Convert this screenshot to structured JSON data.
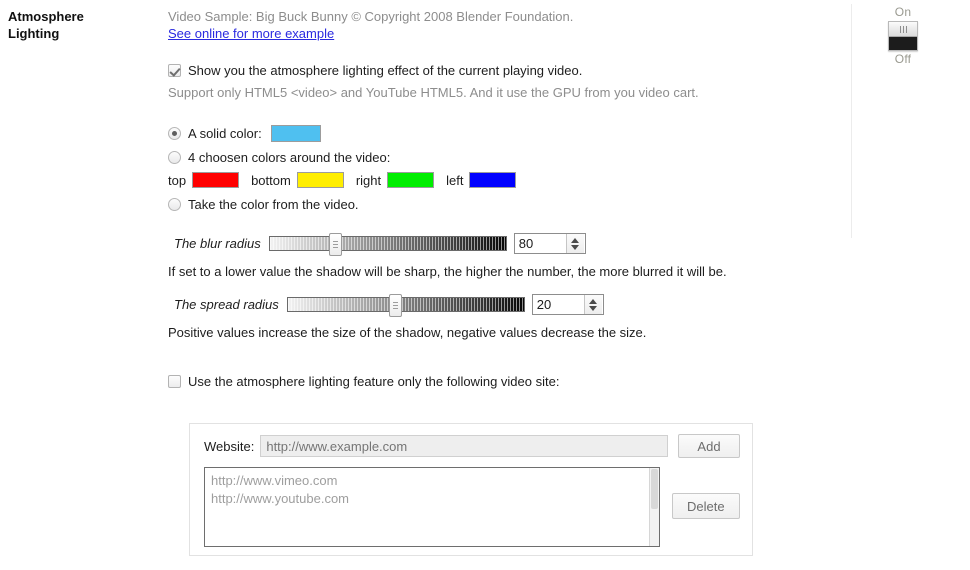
{
  "section": {
    "title": "Atmosphere Lighting"
  },
  "power": {
    "on_label": "On",
    "off_label": "Off",
    "state": "On"
  },
  "credit": {
    "text": "Video Sample: Big Buck Bunny © Copyright 2008 Blender Foundation.",
    "link_text": "See online for more example"
  },
  "enable": {
    "label": "Show you the atmosphere lighting effect of the current playing video.",
    "checked": true,
    "note": "Support only HTML5 <video> and YouTube HTML5. And it use the GPU from you video cart."
  },
  "color_mode": {
    "options": [
      {
        "label": "A solid color:",
        "selected": true
      },
      {
        "label": "4 choosen colors around the video:",
        "selected": false
      },
      {
        "label": "Take the color from the video.",
        "selected": false
      }
    ],
    "solid_color": "#4FC0F0",
    "quad": [
      {
        "label": "top",
        "color": "#FF0000"
      },
      {
        "label": "bottom",
        "color": "#FFEE00"
      },
      {
        "label": "right",
        "color": "#00EE00"
      },
      {
        "label": "left",
        "color": "#0000FF"
      }
    ]
  },
  "blur": {
    "label": "The blur radius",
    "value": "80",
    "fill_percent": 26,
    "description": "If set to a lower value the shadow will be sharp, the higher the number, the more blurred it will be."
  },
  "spread": {
    "label": "The spread radius",
    "value": "20",
    "fill_percent": 45,
    "description": "Positive values increase the size of the shadow, negative values decrease the size."
  },
  "site_filter": {
    "label": "Use the atmosphere lighting feature only the following video site:",
    "checked": false,
    "website_label": "Website:",
    "website_value": "",
    "website_placeholder": "http://www.example.com",
    "add_label": "Add",
    "delete_label": "Delete",
    "sites": [
      "http://www.vimeo.com",
      "http://www.youtube.com"
    ]
  }
}
